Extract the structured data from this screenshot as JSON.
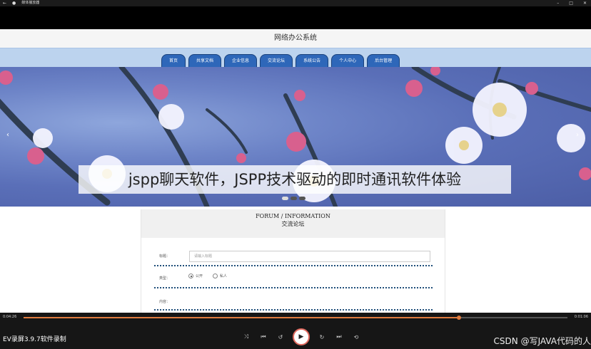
{
  "player": {
    "window_title": "媒体播放器",
    "current_time": "0:04:26",
    "total_time": "0:01:06",
    "progress": 0.8,
    "recorder_label": "EV录屏3.9.7软件录制",
    "watermark": "CSDN @写JAVA代码的人"
  },
  "site": {
    "title": "网络办公系统",
    "nav": [
      "首页",
      "共享文档",
      "企业信息",
      "交流论坛",
      "系统公告",
      "个人中心",
      "后台管理"
    ]
  },
  "subtitle": "jspp聊天软件，JSPP技术驱动的即时通讯软件体验",
  "forum": {
    "title_en": "FORUM / INFORMATION",
    "title_cn": "交流论坛",
    "title_label": "标题：",
    "title_placeholder": "请输入标题",
    "type_label": "类型：",
    "type_options": [
      "公开",
      "私人"
    ],
    "content_label": "内容："
  },
  "icons": {
    "back": "back-arrow-icon",
    "app": "player-app-icon",
    "min": "minimize-icon",
    "max": "maximize-icon",
    "close": "close-icon"
  },
  "colors": {
    "nav_tab": "#2e67b9",
    "navbar": "#bcd3ee",
    "progress": "#e07b3f"
  }
}
